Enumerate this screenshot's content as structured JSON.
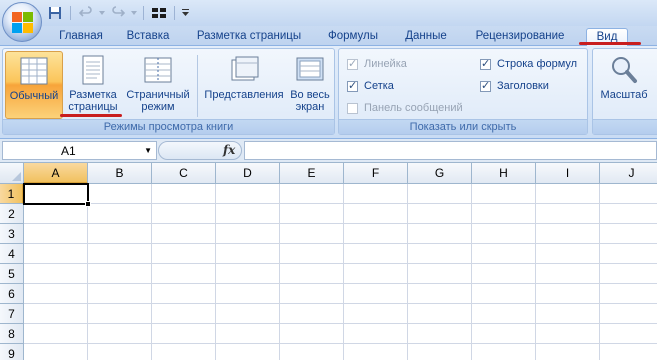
{
  "quick_access": {
    "icons": [
      "save-icon",
      "undo-icon",
      "redo-icon",
      "layout-icon",
      "customize-icon"
    ]
  },
  "tabs": [
    {
      "label": "Главная",
      "active": false
    },
    {
      "label": "Вставка",
      "active": false
    },
    {
      "label": "Разметка страницы",
      "active": false
    },
    {
      "label": "Формулы",
      "active": false
    },
    {
      "label": "Данные",
      "active": false
    },
    {
      "label": "Рецензирование",
      "active": false
    },
    {
      "label": "Вид",
      "active": true
    }
  ],
  "ribbon": {
    "view_modes_group": {
      "label": "Режимы просмотра книги",
      "normal": "Обычный",
      "page_layout_1": "Разметка",
      "page_layout_2": "страницы",
      "page_break_1": "Страничный",
      "page_break_2": "режим",
      "views": "Представления",
      "fullscreen_1": "Во весь",
      "fullscreen_2": "экран"
    },
    "show_hide_group": {
      "label": "Показать или скрыть",
      "ruler": "Линейка",
      "gridlines": "Сетка",
      "message_bar": "Панель сообщений",
      "formula_bar": "Строка формул",
      "headings": "Заголовки"
    },
    "zoom_group": {
      "zoom": "Масштаб"
    }
  },
  "formula_bar": {
    "name_box": "A1",
    "fx": "fx",
    "value": ""
  },
  "columns": [
    "A",
    "B",
    "C",
    "D",
    "E",
    "F",
    "G",
    "H",
    "I",
    "J"
  ],
  "rows": [
    "1",
    "2",
    "3",
    "4",
    "5",
    "6",
    "7",
    "8",
    "9"
  ],
  "colors": {
    "accent": "#15428b",
    "active_button": "#fbc55a",
    "annotation": "#c81e1e"
  }
}
